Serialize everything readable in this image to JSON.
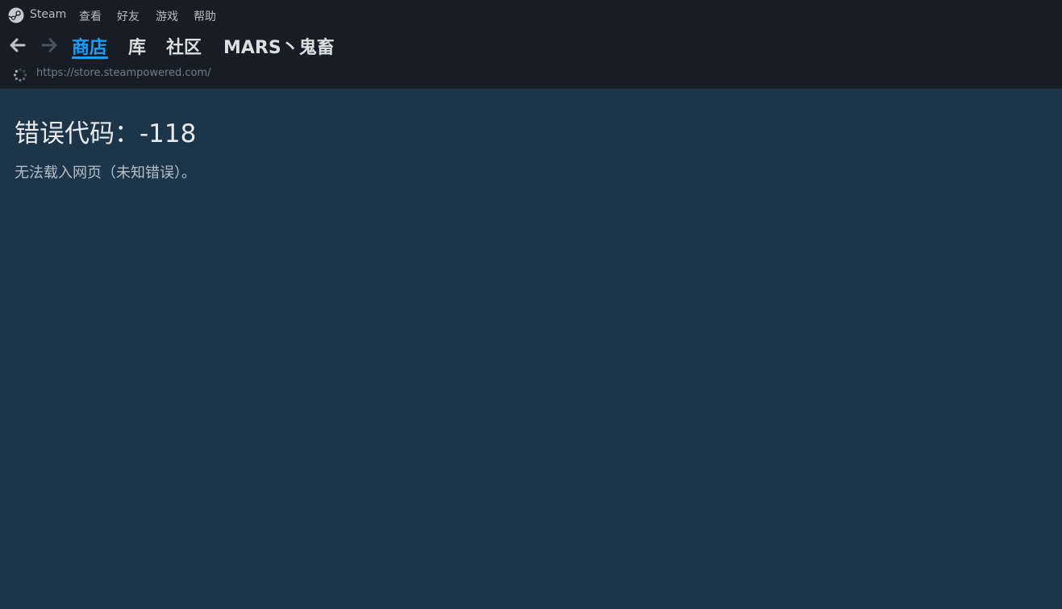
{
  "menubar": {
    "app_name": "Steam",
    "items": [
      "查看",
      "好友",
      "游戏",
      "帮助"
    ]
  },
  "nav": {
    "back_icon": "arrow-left-icon",
    "forward_icon": "arrow-right-icon",
    "tabs": [
      {
        "label": "商店",
        "active": true
      },
      {
        "label": "库",
        "active": false
      },
      {
        "label": "社区",
        "active": false
      },
      {
        "label": "MARS丶鬼畜",
        "active": false
      }
    ]
  },
  "urlbar": {
    "loading_icon": "spinner-icon",
    "url": "https://store.steampowered.com/"
  },
  "error": {
    "title": "错误代码：-118",
    "message": "无法载入网页（未知错误）。"
  },
  "colors": {
    "chrome_bg": "#171d25",
    "content_bg": "#1d3549",
    "accent": "#1a9fff"
  }
}
